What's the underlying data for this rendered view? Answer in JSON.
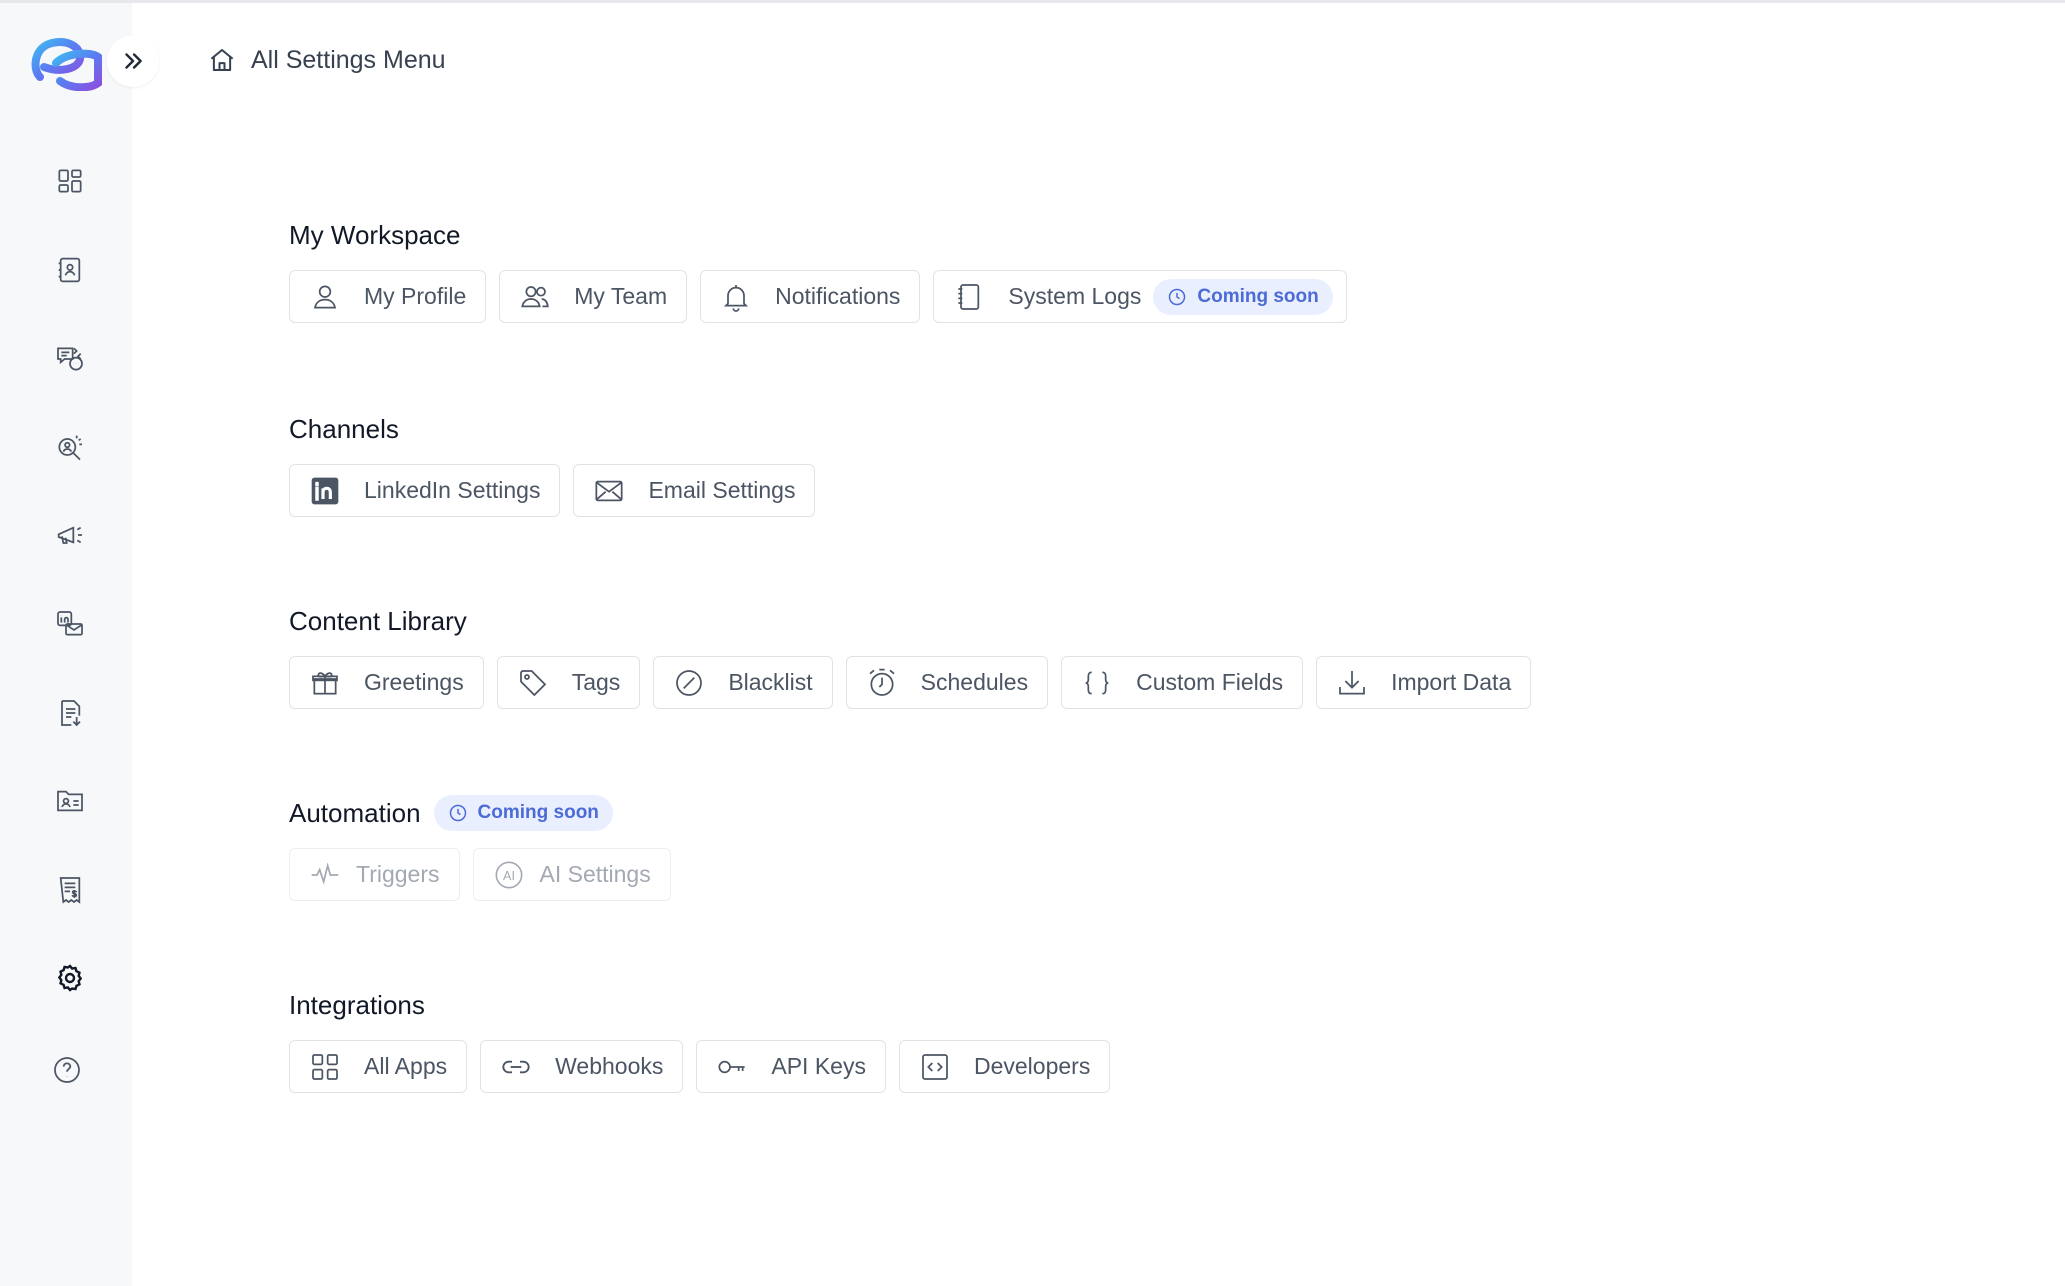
{
  "header": {
    "title": "All Settings Menu",
    "home_icon": "home-icon"
  },
  "sidebar": {
    "logo": "app-logo",
    "expand_icon": "chevrons-right-icon",
    "items": [
      {
        "name": "dashboard",
        "icon": "dashboard-grid-icon"
      },
      {
        "name": "contacts",
        "icon": "contact-book-icon"
      },
      {
        "name": "conversations",
        "icon": "chat-bubbles-icon"
      },
      {
        "name": "prospect-search",
        "icon": "person-search-icon"
      },
      {
        "name": "campaigns",
        "icon": "megaphone-icon"
      },
      {
        "name": "multichannel",
        "icon": "linkedin-email-icon"
      },
      {
        "name": "reports",
        "icon": "document-download-icon"
      },
      {
        "name": "files",
        "icon": "folder-person-icon"
      },
      {
        "name": "billing",
        "icon": "invoice-dollar-icon"
      },
      {
        "name": "settings",
        "icon": "gear-icon",
        "active": true
      },
      {
        "name": "help",
        "icon": "help-circle-icon"
      }
    ]
  },
  "sections": {
    "workspace": {
      "title": "My Workspace",
      "items": [
        {
          "label": "My Profile",
          "icon": "user-icon"
        },
        {
          "label": "My Team",
          "icon": "team-icon"
        },
        {
          "label": "Notifications",
          "icon": "bell-icon"
        },
        {
          "label": "System Logs",
          "icon": "notebook-icon",
          "badge": "Coming soon"
        }
      ]
    },
    "channels": {
      "title": "Channels",
      "items": [
        {
          "label": "LinkedIn Settings",
          "icon": "linkedin-icon"
        },
        {
          "label": "Email Settings",
          "icon": "envelope-icon"
        }
      ]
    },
    "content": {
      "title": "Content Library",
      "items": [
        {
          "label": "Greetings",
          "icon": "gift-icon"
        },
        {
          "label": "Tags",
          "icon": "tag-icon"
        },
        {
          "label": "Blacklist",
          "icon": "block-icon"
        },
        {
          "label": "Schedules",
          "icon": "alarm-clock-icon"
        },
        {
          "label": "Custom Fields",
          "icon": "braces-icon"
        },
        {
          "label": "Import Data",
          "icon": "download-icon"
        }
      ]
    },
    "automation": {
      "title": "Automation",
      "badge": "Coming soon",
      "items": [
        {
          "label": "Triggers",
          "icon": "pulse-icon"
        },
        {
          "label": "AI Settings",
          "icon": "ai-circle-icon"
        }
      ]
    },
    "integrations": {
      "title": "Integrations",
      "items": [
        {
          "label": "All Apps",
          "icon": "apps-grid-icon"
        },
        {
          "label": "Webhooks",
          "icon": "link-icon"
        },
        {
          "label": "API Keys",
          "icon": "key-icon"
        },
        {
          "label": "Developers",
          "icon": "code-icon"
        }
      ]
    }
  },
  "colors": {
    "accent": "#4b6bd6",
    "badge_bg": "#e9efff",
    "sidebar_bg": "#f7f8fa",
    "chip_border": "#dfe3e8"
  }
}
